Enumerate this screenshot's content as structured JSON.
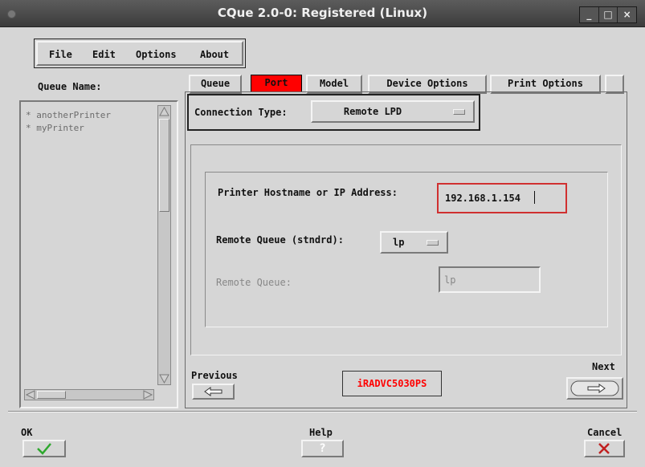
{
  "window": {
    "title": "CQue 2.0-0: Registered (Linux)",
    "controls": [
      "_",
      "□",
      "×"
    ]
  },
  "menu": {
    "items": [
      "File",
      "Edit",
      "Options",
      "About"
    ]
  },
  "queue_list": {
    "label": "Queue Name:",
    "items": [
      "anotherPrinter",
      "myPrinter"
    ],
    "bullet": "*"
  },
  "tabs": [
    {
      "label": "Queue",
      "active": false
    },
    {
      "label": "Port",
      "active": true
    },
    {
      "label": "Model",
      "active": false
    },
    {
      "label": "Device Options",
      "active": false
    },
    {
      "label": "Print Options",
      "active": false
    }
  ],
  "connection": {
    "label": "Connection Type:",
    "value": "Remote LPD"
  },
  "host": {
    "label": "Printer Hostname or IP Address:",
    "value": "192.168.1.154"
  },
  "remote_queue_std": {
    "label": "Remote Queue (stndrd):",
    "value": "lp"
  },
  "remote_queue": {
    "label": "Remote Queue:",
    "value": "lp"
  },
  "nav": {
    "previous": "Previous",
    "next": "Next",
    "model": "iRADVC5030PS"
  },
  "footer": {
    "ok": "OK",
    "help": "Help",
    "help_icon": "?",
    "cancel": "Cancel"
  },
  "colors": {
    "active_tab": "#ff0000",
    "model_text": "#ff0000",
    "focus_border": "#d03030",
    "ok_check": "#2ea82e",
    "cancel_x": "#c02020"
  },
  "icons": {
    "previous": "left-arrow-icon",
    "next": "right-arrow-icon",
    "ok": "check-icon",
    "help": "question-icon",
    "cancel": "x-icon"
  }
}
